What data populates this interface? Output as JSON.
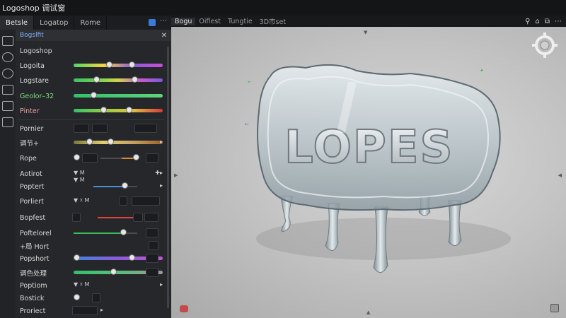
{
  "window": {
    "title": "Logoshop 调试窗"
  },
  "left_tabs": [
    {
      "label": "Betsle",
      "active": true
    },
    {
      "label": "Logatop",
      "active": false
    },
    {
      "label": "Rome",
      "active": false
    }
  ],
  "panel": {
    "header": "Bogslfit",
    "rows": [
      {
        "label": "Logoshop"
      },
      {
        "label": "Logoita"
      },
      {
        "label": "Logstare"
      },
      {
        "label": "Geolor–32",
        "label_color": "#7ee07e",
        "icon": "✚"
      },
      {
        "label": "Pinter",
        "label_color": "#e8a0a0",
        "icon": "♥"
      },
      {
        "label": "Pornier"
      },
      {
        "label": "调节+"
      },
      {
        "label": "Rope"
      },
      {
        "label": "Aotirot"
      },
      {
        "label": "Poptert"
      },
      {
        "label": "Porliert"
      },
      {
        "label": "Bopfest"
      },
      {
        "label": "Poftelorel"
      },
      {
        "label": "+局 Hort"
      },
      {
        "label": "Popshort"
      },
      {
        "label": "调色处理"
      },
      {
        "label": "Poptiom"
      },
      {
        "label": "Bostick"
      },
      {
        "label": "Proriect"
      }
    ]
  },
  "viewport": {
    "tabs": [
      {
        "label": "Bogu",
        "active": true
      },
      {
        "label": "Oiflest",
        "active": false
      },
      {
        "label": "Tungtie",
        "active": false
      },
      {
        "label": "3D市set",
        "active": false
      }
    ],
    "logo_text": "LOPES"
  },
  "colors": {
    "accent": "#3b7ad8",
    "panel_bg": "#26272a",
    "viewport_bg": "#c8c8c8"
  },
  "icons": [
    "search-icon",
    "home-icon",
    "share-icon",
    "more-icon",
    "close-icon",
    "settings-gizmo-icon",
    "record-icon"
  ]
}
